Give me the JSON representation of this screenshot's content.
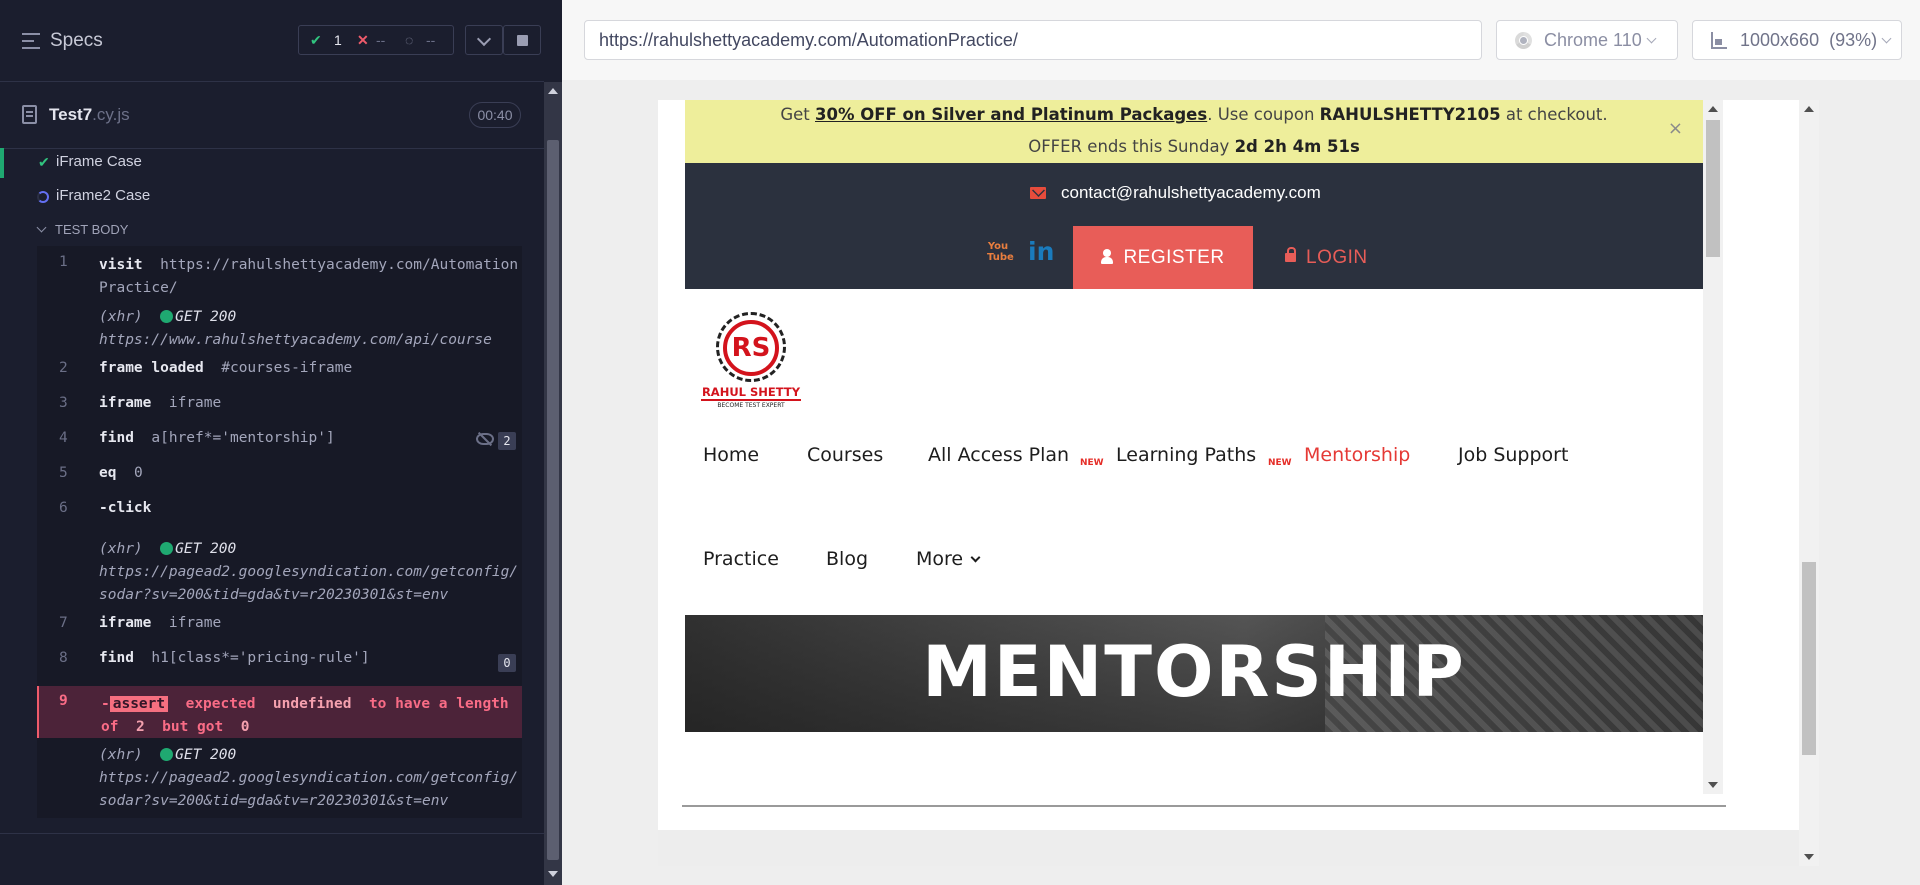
{
  "reporter": {
    "header_title": "Specs",
    "stats": {
      "passed": "1",
      "failed": "--",
      "pending": "--"
    },
    "spec": {
      "name": "Test7",
      "ext": ".cy.js",
      "duration": "00:40"
    },
    "suites": [
      {
        "label": "iFrame Case",
        "state": "passed"
      },
      {
        "label": "iFrame2 Case",
        "state": "running"
      }
    ],
    "test_body_label": "TEST BODY",
    "commands": [
      {
        "num": "1",
        "name": "visit",
        "msg": "https://rahulshettyacademy.com/AutomationPractice/"
      },
      {
        "xhr": "(xhr)",
        "status": "GET 200",
        "url": "https://www.rahulshettyacademy.com/api/course"
      },
      {
        "num": "2",
        "name": "frame loaded",
        "msg": "#courses-iframe"
      },
      {
        "num": "3",
        "name": "iframe",
        "msg": "iframe"
      },
      {
        "num": "4",
        "name": "find",
        "msg": "a[href*='mentorship']",
        "badge": "2"
      },
      {
        "num": "5",
        "name": "eq",
        "msg": "0"
      },
      {
        "num": "6",
        "name": "-click",
        "msg": ""
      },
      {
        "xhr": "(xhr)",
        "status": "GET 200",
        "url": "https://pagead2.googlesyndication.com/getconfig/sodar?sv=200&tid=gda&tv=r20230301&st=env"
      },
      {
        "num": "7",
        "name": "iframe",
        "msg": "iframe"
      },
      {
        "num": "8",
        "name": "find",
        "msg": "h1[class*='pricing-rule']",
        "badge": "0"
      },
      {
        "num": "9",
        "assert": "assert",
        "err_parts": [
          "expected",
          "undefined",
          "to have a length of",
          "2",
          "but got",
          "0"
        ]
      },
      {
        "xhr": "(xhr)",
        "status": "GET 200",
        "url": "https://pagead2.googlesyndication.com/getconfig/sodar?sv=200&tid=gda&tv=r20230301&st=env"
      }
    ]
  },
  "aut": {
    "url": "https://rahulshettyacademy.com/AutomationPractice/",
    "browser": "Chrome 110",
    "viewport": "1000x660",
    "scale": "(93%)"
  },
  "iframe_page": {
    "promo": {
      "prefix": "Get ",
      "link": "30% OFF on Silver and Platinum Packages",
      "mid": ". Use coupon ",
      "coupon": "RAHULSHETTY2105",
      "suffix": " at checkout.",
      "offer_prefix": "OFFER ends this Sunday ",
      "countdown": "2d 2h 4m 51s",
      "close": "×"
    },
    "email": "contact@rahulshettyacademy.com",
    "register": "REGISTER",
    "login": "LOGIN",
    "youtube_text": "You Tube",
    "linkedin_text": "in",
    "logo": {
      "initials": "RS",
      "name": "RAHUL SHETTY",
      "tagline": "BECOME TEST EXPERT"
    },
    "nav": [
      "Home",
      "Courses",
      "All Access Plan",
      "Learning Paths",
      "Mentorship",
      "Job Support",
      "Practice",
      "Blog",
      "More"
    ],
    "new_tag": "NEW",
    "hero_title": "MENTORSHIP"
  },
  "colors": {
    "pass": "#1fa971",
    "error": "#f96c86",
    "accent_red": "#e85d58",
    "promo_bg": "#eeee9b"
  }
}
